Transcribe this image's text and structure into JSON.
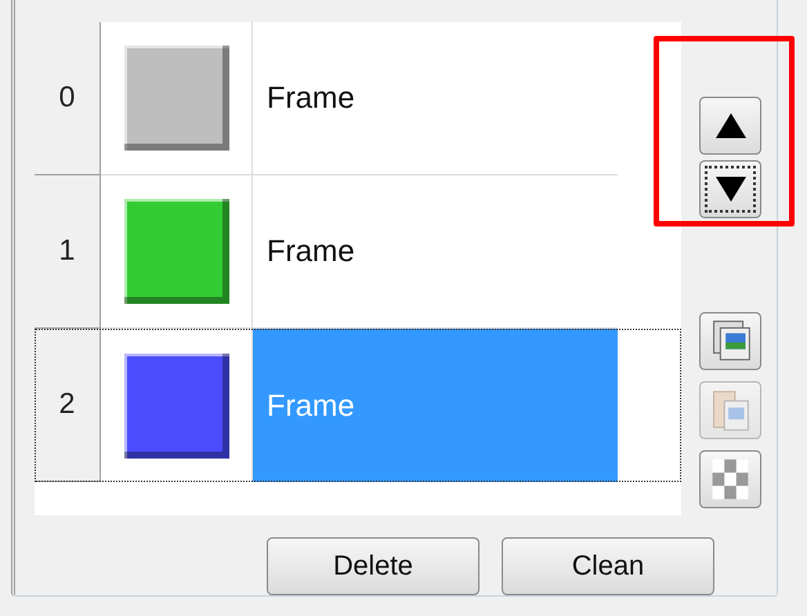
{
  "rows": [
    {
      "index": "0",
      "color": "#bebebe",
      "label": "Frame",
      "selected": false
    },
    {
      "index": "1",
      "color": "#33cc33",
      "label": "Frame",
      "selected": false
    },
    {
      "index": "2",
      "color": "#4c4cff",
      "label": "Frame",
      "selected": true
    }
  ],
  "order_buttons": [
    {
      "kind": "up",
      "focused": false
    },
    {
      "kind": "down",
      "focused": true
    }
  ],
  "tool_buttons": [
    {
      "kind": "copy",
      "disabled": false
    },
    {
      "kind": "paste",
      "disabled": true
    },
    {
      "kind": "checker",
      "disabled": false
    }
  ],
  "buttons": [
    "Delete",
    "Clean"
  ]
}
